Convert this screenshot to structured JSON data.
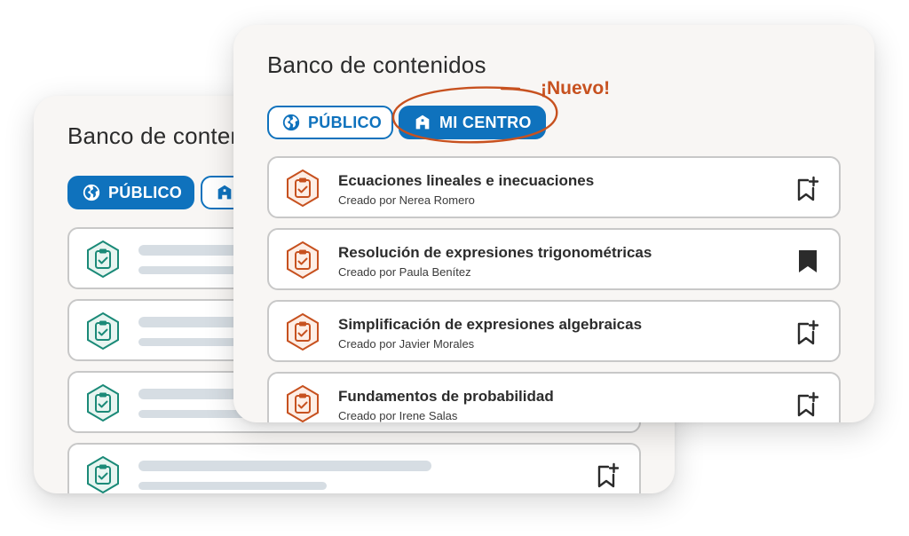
{
  "back_card": {
    "title": "Banco de contenidos",
    "tabs": {
      "publico": "PÚBLICO",
      "centro": "MI CENTRO"
    }
  },
  "front_card": {
    "title": "Banco de contenidos",
    "tabs": {
      "publico": "PÚBLICO",
      "centro": "MI CENTRO"
    },
    "new_badge": "¡Nuevo!",
    "items": [
      {
        "title": "Ecuaciones lineales e inecuaciones",
        "author": "Creado por Nerea Romero",
        "bookmark": "add"
      },
      {
        "title": "Resolución de expresiones trigonométricas",
        "author": "Creado por Paula Benítez",
        "bookmark": "saved"
      },
      {
        "title": "Simplificación de expresiones algebraicas",
        "author": "Creado por Javier Morales",
        "bookmark": "add"
      },
      {
        "title": "Fundamentos de probabilidad",
        "author": "Creado por Irene Salas",
        "bookmark": "add"
      }
    ]
  },
  "colors": {
    "primary": "#0f72bd",
    "accent_orange": "#c7511f",
    "teal_icon": "#1b8a78",
    "card_bg": "#f8f6f4",
    "placeholder": "#d6dde3"
  },
  "icons": {
    "publico_tab": "globe-icon",
    "centro_tab": "school-building-icon",
    "item": "hexagon-clipboard-check-icon",
    "bookmark_add": "bookmark-plus-icon",
    "bookmark_saved": "bookmark-filled-icon"
  }
}
